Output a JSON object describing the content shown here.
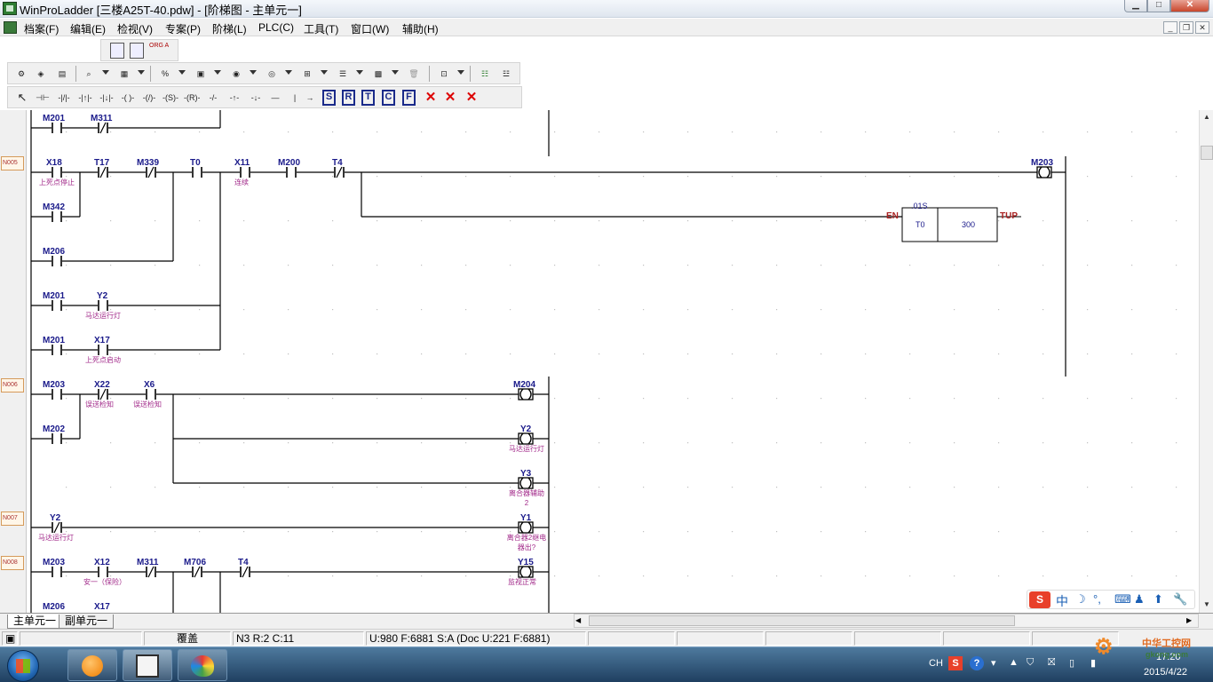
{
  "window": {
    "title": "WinProLadder [三楼A25T-40.pdw] - [阶梯图 - 主单元一]"
  },
  "menu": {
    "items": [
      {
        "label": "档案(F)"
      },
      {
        "label": "编辑(E)"
      },
      {
        "label": "检视(V)"
      },
      {
        "label": "专案(P)"
      },
      {
        "label": "阶梯(L)"
      },
      {
        "label": "PLC(C)"
      },
      {
        "label": "工具(T)"
      },
      {
        "label": "窗口(W)"
      },
      {
        "label": "辅助(H)"
      }
    ]
  },
  "toolbar_top": {
    "org_and": "ORG AND"
  },
  "toolbar_ladder": {
    "symbols": [
      "-|/|-",
      "-|↑|-",
      "-|↓|-",
      "-(  )-",
      "-(/)-",
      "-(S)-",
      "-(R)-",
      "-/-",
      "-↑-",
      "-↓-",
      "—",
      "|",
      "→",
      "S",
      "R",
      "T",
      "C",
      "F",
      "X",
      "X",
      "X"
    ]
  },
  "rungs": {
    "n005": "N005",
    "n006": "N006",
    "n007": "N007",
    "n008": "N008"
  },
  "devices": {
    "m201_top": "M201",
    "m311_top": "M311",
    "x18": "X18",
    "t17": "T17",
    "m339": "M339",
    "t0": "T0",
    "x11": "X11",
    "m200": "M200",
    "t4_a": "T4",
    "m203_coil": "M203",
    "m342": "M342",
    "m206_a": "M206",
    "m201_b": "M201",
    "y2_a": "Y2",
    "m201_c": "M201",
    "x17_a": "X17",
    "m203_b": "M203",
    "x22": "X22",
    "x6": "X6",
    "m204_coil": "M204",
    "m202": "M202",
    "y2_coil": "Y2",
    "y3_coil": "Y3",
    "y2_b": "Y2",
    "y1_coil": "Y1",
    "m203_c": "M203",
    "x12": "X12",
    "m311_b": "M311",
    "m706": "M706",
    "t4_b": "T4",
    "y15_coil": "Y15",
    "m206_b": "M206",
    "x17_b": "X17"
  },
  "comments": {
    "x18": "上死点停止",
    "x11": "连续",
    "y2_a": "马达运行灯",
    "x17_a": "上死点启动",
    "x22": "误送检知",
    "x6": "误送检知",
    "y2_coil": "马达运行灯",
    "y3_coil": "离合器辅助2",
    "y2_b": "马达运行灯",
    "y1_coil": "离合器2继电器出?",
    "x12": "安一（保险）",
    "y15_coil": "监视正常"
  },
  "timer": {
    "en": "EN",
    "base": ".01S",
    "name": "T0",
    "preset": "300",
    "tup": "TUP"
  },
  "tabs": {
    "main": "主单元一",
    "sub": "副单元一"
  },
  "status": {
    "mode": "覆盖",
    "cursor": "N3 R:2 C:11",
    "usage": "U:980 F:6881 S:A (Doc U:221 F:6881)"
  },
  "taskbar": {
    "lang": "CH",
    "time": "17:20",
    "date": "2015/4/22"
  },
  "watermark": {
    "brand": "中华工控网",
    "site": "gkong.com"
  }
}
